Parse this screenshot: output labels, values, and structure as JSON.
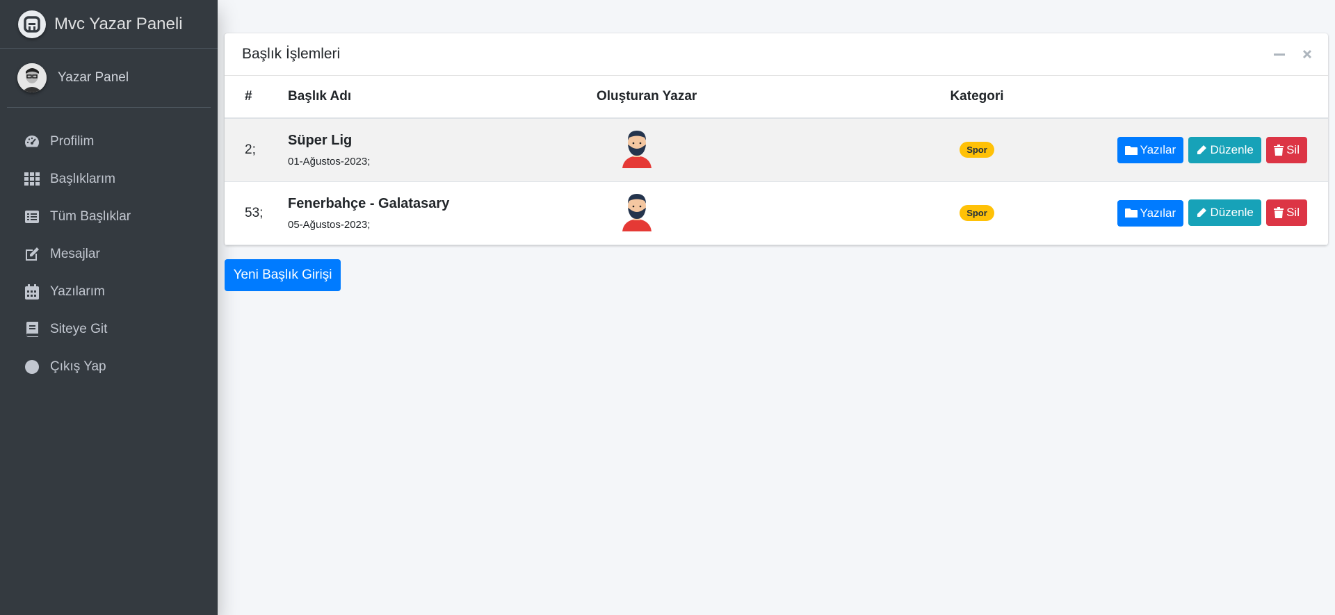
{
  "sidebar": {
    "brand": "Mvc Yazar Paneli",
    "user_name": "Yazar Panel",
    "items": [
      {
        "label": "Profilim",
        "icon": "dashboard-gauge-icon"
      },
      {
        "label": "Başlıklarım",
        "icon": "grid-icon"
      },
      {
        "label": "Tüm Başlıklar",
        "icon": "list-icon"
      },
      {
        "label": "Mesajlar",
        "icon": "edit-icon"
      },
      {
        "label": "Yazılarım",
        "icon": "calendar-icon"
      },
      {
        "label": "Siteye Git",
        "icon": "book-icon"
      },
      {
        "label": "Çıkış Yap",
        "icon": "circle-icon"
      }
    ]
  },
  "card": {
    "title": "Başlık İşlemleri",
    "columns": [
      "#",
      "Başlık Adı",
      "Oluşturan Yazar",
      "Kategori"
    ],
    "rows": [
      {
        "id": "2;",
        "title": "Süper Lig",
        "date": "01-Ağustos-2023;",
        "category": "Spor"
      },
      {
        "id": "53;",
        "title": "Fenerbahçe - Galatasary",
        "date": "05-Ağustos-2023;",
        "category": "Spor"
      }
    ],
    "buttons": {
      "posts": "Yazılar",
      "edit": "Düzenle",
      "delete": "Sil"
    }
  },
  "new_button": "Yeni Başlık Girişi",
  "colors": {
    "sidebar_bg": "#343a40",
    "primary": "#007bff",
    "info": "#17a2b8",
    "danger": "#dc3545",
    "warning": "#ffc107"
  }
}
